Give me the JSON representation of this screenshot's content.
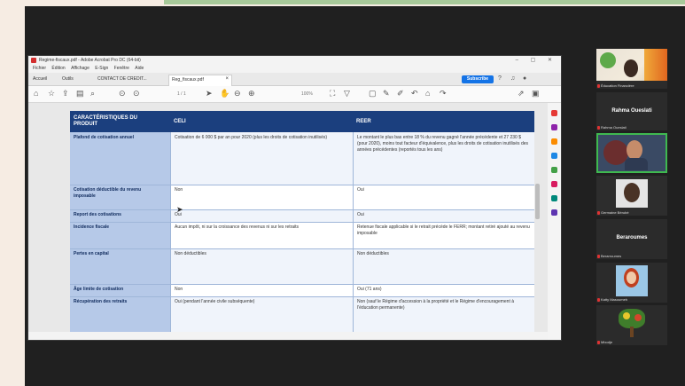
{
  "app": {
    "window_title": "Regime-fiscaux.pdf - Adobe Acrobat Pro DC (64-bit)",
    "menu": [
      "Fichier",
      "Édition",
      "Affichage",
      "E-Sign",
      "Fenêtre",
      "Aide"
    ],
    "tabs": [
      "Accueil",
      "Outils",
      "CONTACT DE CREDIT..."
    ],
    "document_tab": "Reg_fiscaux.pdf",
    "subscribe_label": "Subscribe",
    "page_indicator": "1 / 1",
    "zoom_level": "100%"
  },
  "table": {
    "headers": [
      "CARACTÉRISTIQUES DU PRODUIT",
      "CELI",
      "REER"
    ],
    "rows": [
      {
        "label": "Plafond de cotisation annuel",
        "celi": "Cotisation de 6 000 $ par an pour 2020 (plus les droits de cotisation inutilisés)",
        "reer": "Le montant le plus bas entre 18 % du revenu gagné l'année précédente et 27 230 $ (pour 2020), moins tout facteur d'équivalence, plus les droits de cotisation inutilisés des années précédentes (reportés tous les ans)"
      },
      {
        "label": "Cotisation déductible du revenu imposable",
        "celi": "Non",
        "reer": "Oui"
      },
      {
        "label": "Report des cotisations",
        "celi": "Oui",
        "reer": "Oui"
      },
      {
        "label": "Incidence fiscale",
        "celi": "Aucun impôt, ni sur la croissance des revenus ni sur les retraits",
        "reer": "Retenue fiscale applicable si le retrait précède le FERR; montant retiré ajouté au revenu imposable"
      },
      {
        "label": "Pertes en capital",
        "celi": "Non déductibles",
        "reer": "Non déductibles"
      },
      {
        "label": "Âge limite de cotisation",
        "celi": "Non",
        "reer": "Oui (71 ans)"
      },
      {
        "label": "Récupération des retraits",
        "celi": "Oui (pendant l'année civile subséquente)",
        "reer": "Non (sauf le Régime d'accession à la propriété et le Régime d'encouragement à l'éducation permanente)"
      }
    ]
  },
  "participants": {
    "tile1_name": "Éducation Financière",
    "tile2_big": "Rahma Oueslati",
    "tile2_name": "Rahma Oueslati",
    "tile3_name": "Germaine Bérubé",
    "tile4_name": "Germaine Bérubé",
    "tile5_big": "Beraroumes",
    "tile5_name": "Berarroumes",
    "tile6_name": "Katty Masoumeh",
    "tile7_name": "Mbodje"
  },
  "colors": {
    "table_header": "#1b3f7e",
    "label_column": "#b6c9e8",
    "active_speaker": "#3fb950",
    "subscribe_button": "#1473e6"
  }
}
